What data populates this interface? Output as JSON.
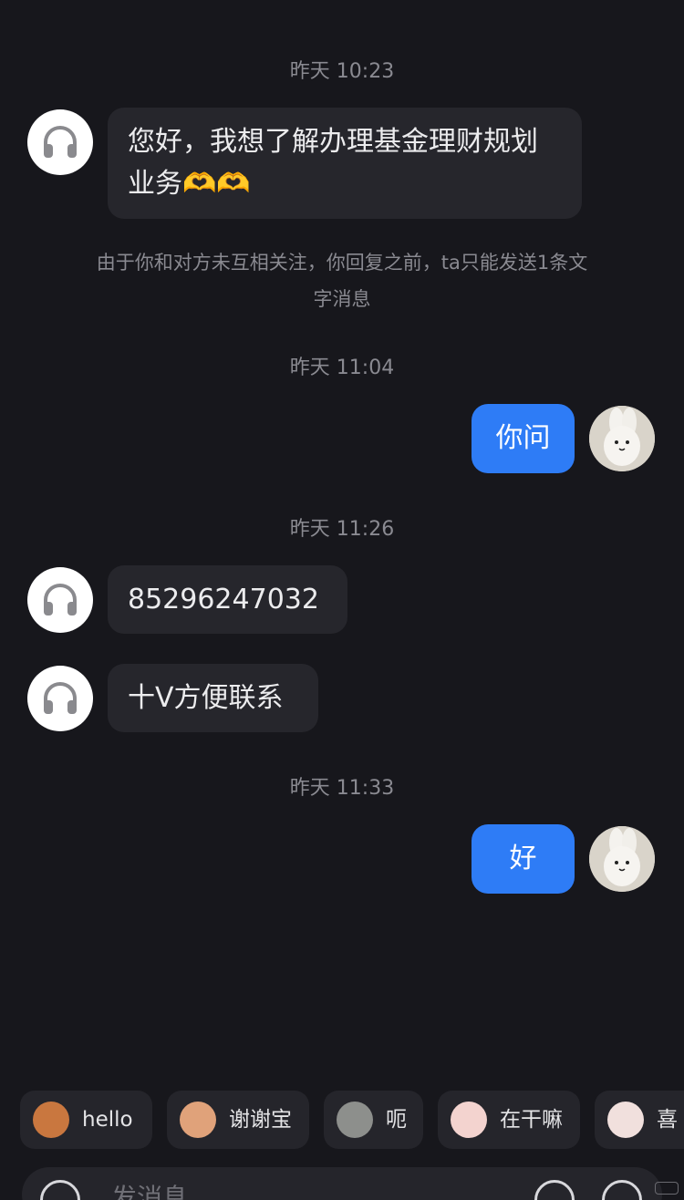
{
  "messages": {
    "ts1": "昨天 10:23",
    "m1_line1": "您好，我想了解办理基金理财规划",
    "m1_line2": "业务🫶🫶",
    "notice_line1": "由于你和对方未互相关注，你回复之前，ta只能发送1条文",
    "notice_line2": "字消息",
    "ts2": "昨天 11:04",
    "m2": "你问",
    "ts3": "昨天 11:26",
    "m3": "85296247032",
    "m4": "十V方便联系",
    "ts4": "昨天 11:33",
    "m5": "好"
  },
  "quick_replies": [
    {
      "label": "hello",
      "icon": "monkey-emoji-icon"
    },
    {
      "label": "谢谢宝",
      "icon": "flower-girl-emoji-icon"
    },
    {
      "label": "呃",
      "icon": "cat-emoji-icon"
    },
    {
      "label": "在干嘛",
      "icon": "magnifier-emoji-icon"
    },
    {
      "label": "喜",
      "icon": "bunny-emoji-icon"
    }
  ],
  "input": {
    "placeholder": "发消息"
  },
  "colors": {
    "background": "#17171c",
    "incoming_bubble": "#26262c",
    "outgoing_bubble": "#2e7cf6",
    "timestamp": "#8a8a91"
  }
}
